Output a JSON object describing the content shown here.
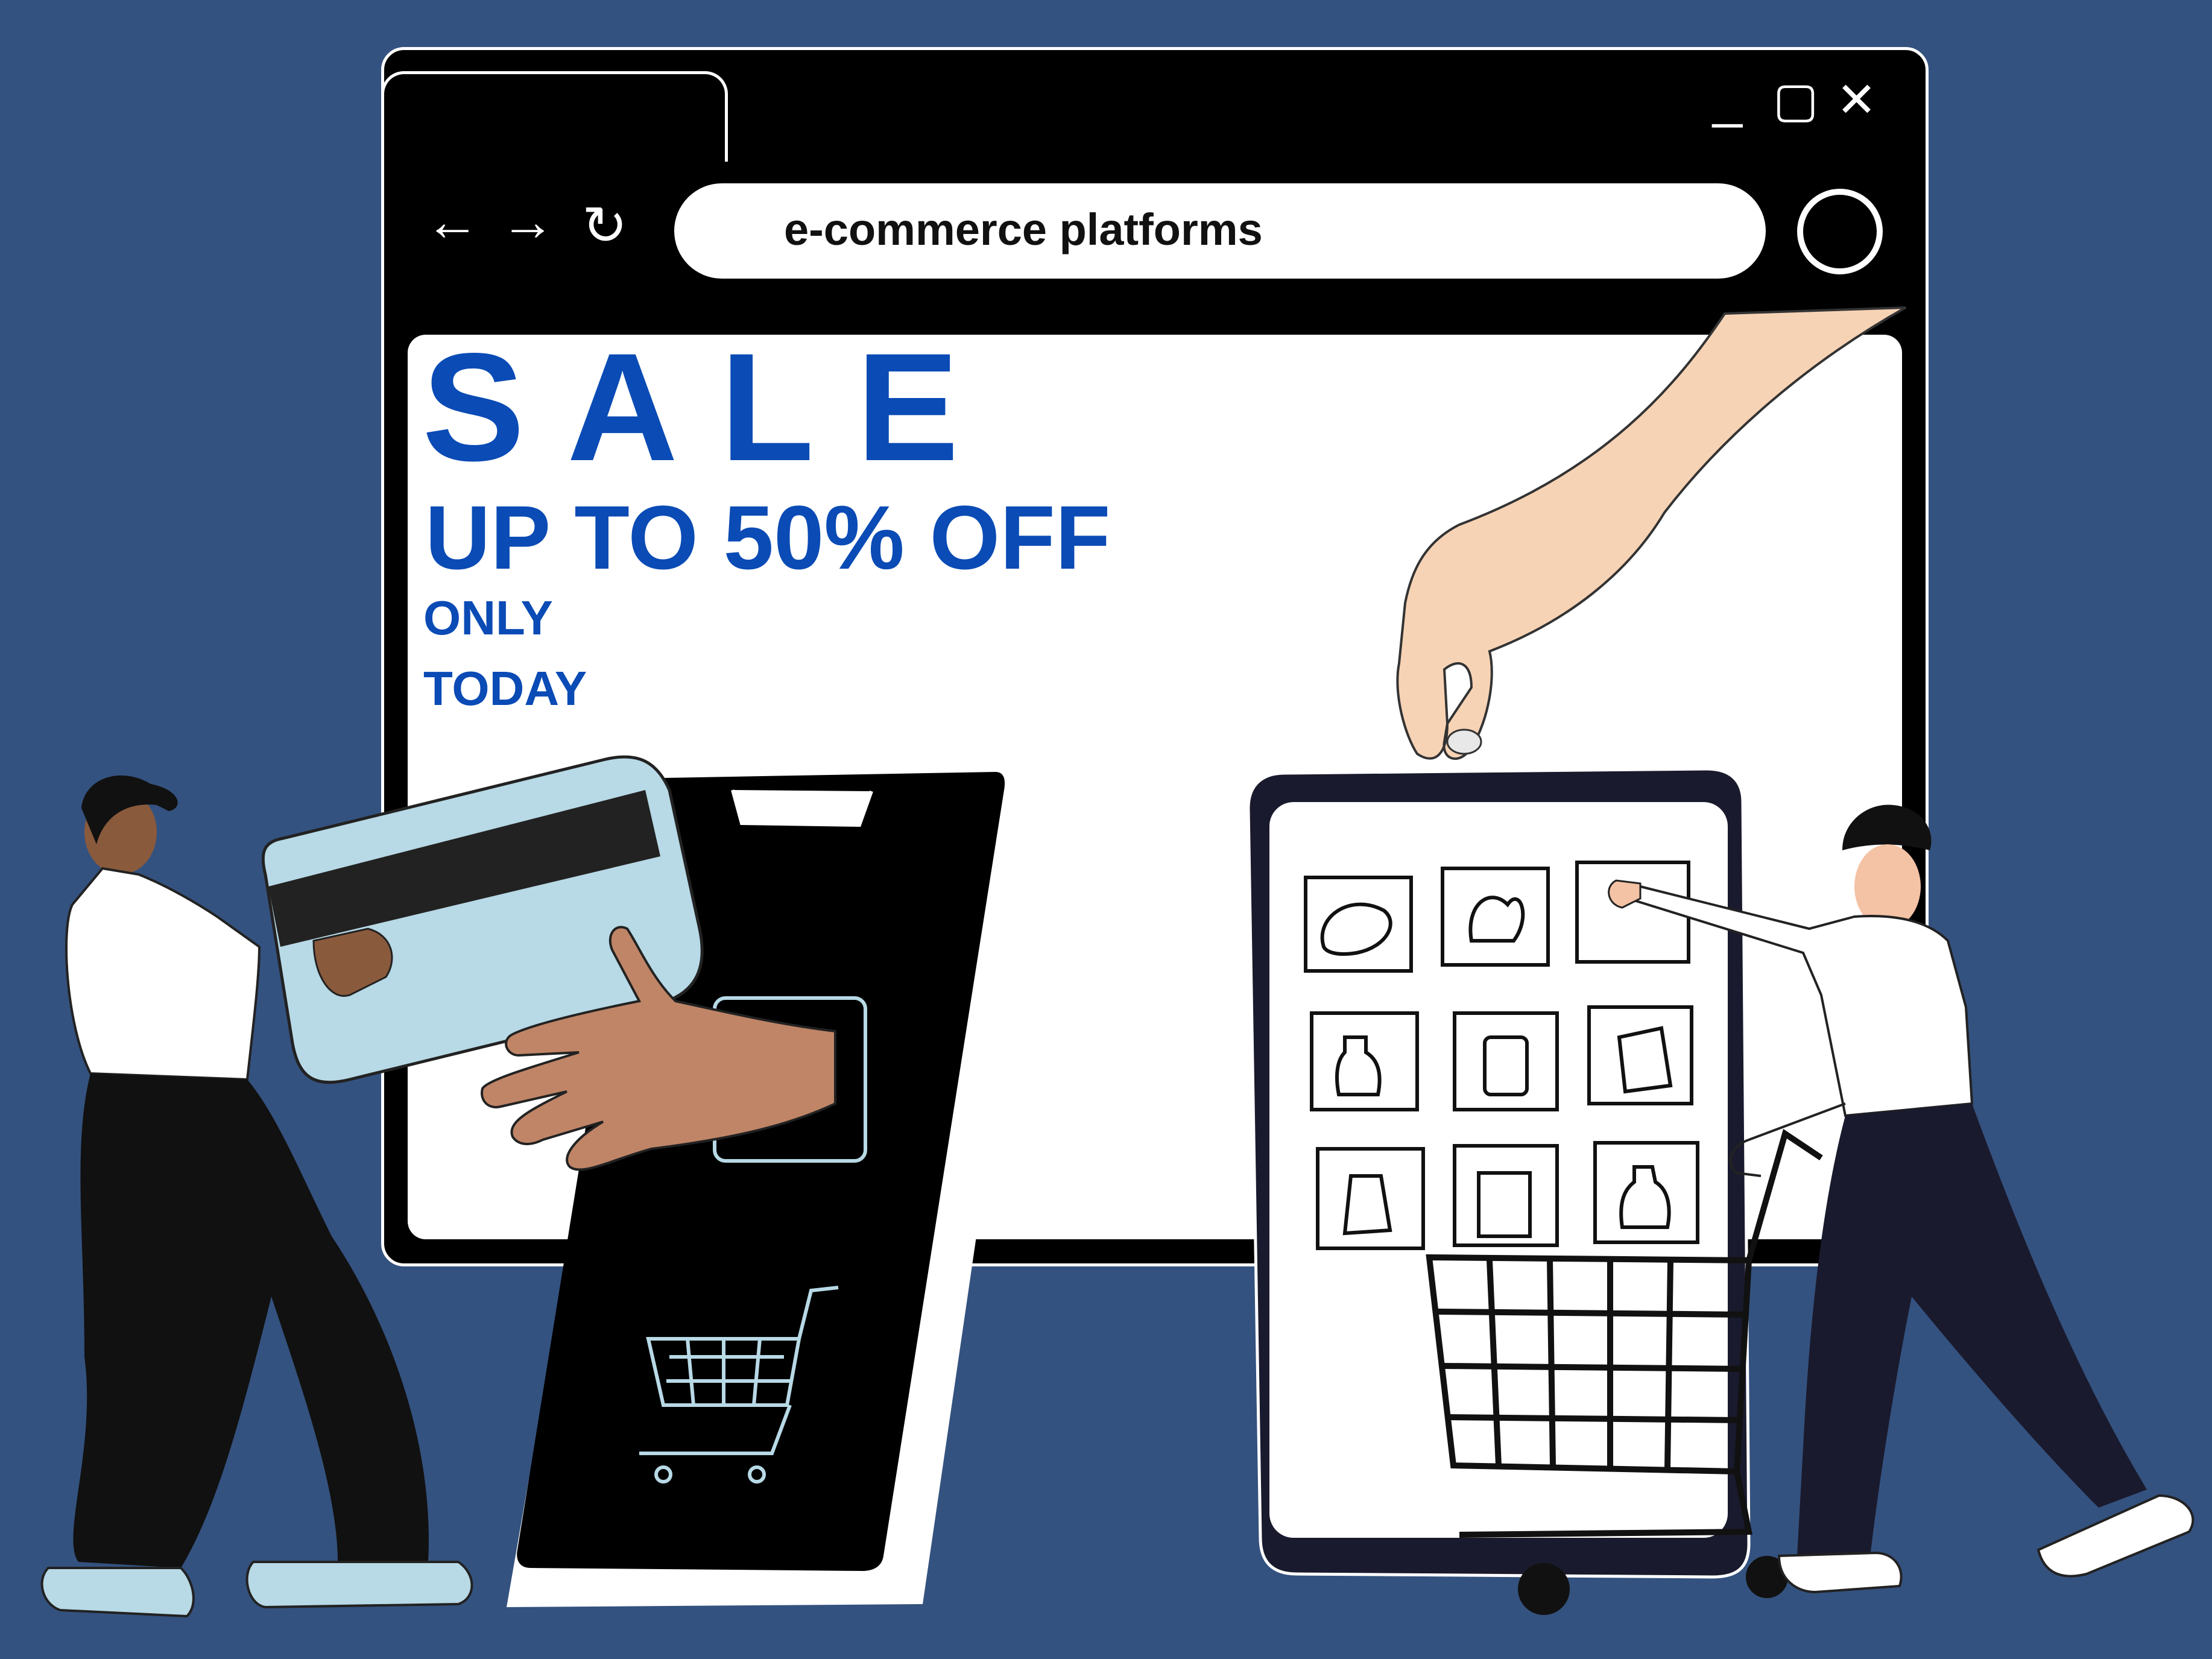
{
  "browser": {
    "address_text": "e-commerce platforms",
    "back_glyph": "←",
    "forward_glyph": "→",
    "reload_glyph": "↻",
    "minimize_glyph": "_",
    "maximize_glyph": "▢",
    "close_glyph": "✕"
  },
  "banner": {
    "headline": "SALE",
    "offer": "UP TO 50% OFF",
    "line1": "ONLY",
    "line2": "TODAY"
  },
  "icons": {
    "back": "arrow-left-icon",
    "forward": "arrow-right-icon",
    "reload": "reload-icon",
    "profile": "profile-circle-icon",
    "cart": "shopping-cart-icon"
  },
  "colors": {
    "background": "#34527f",
    "accent_text": "#0a4bb5",
    "browser_frame": "#000000",
    "card": "#b8d9e6"
  }
}
